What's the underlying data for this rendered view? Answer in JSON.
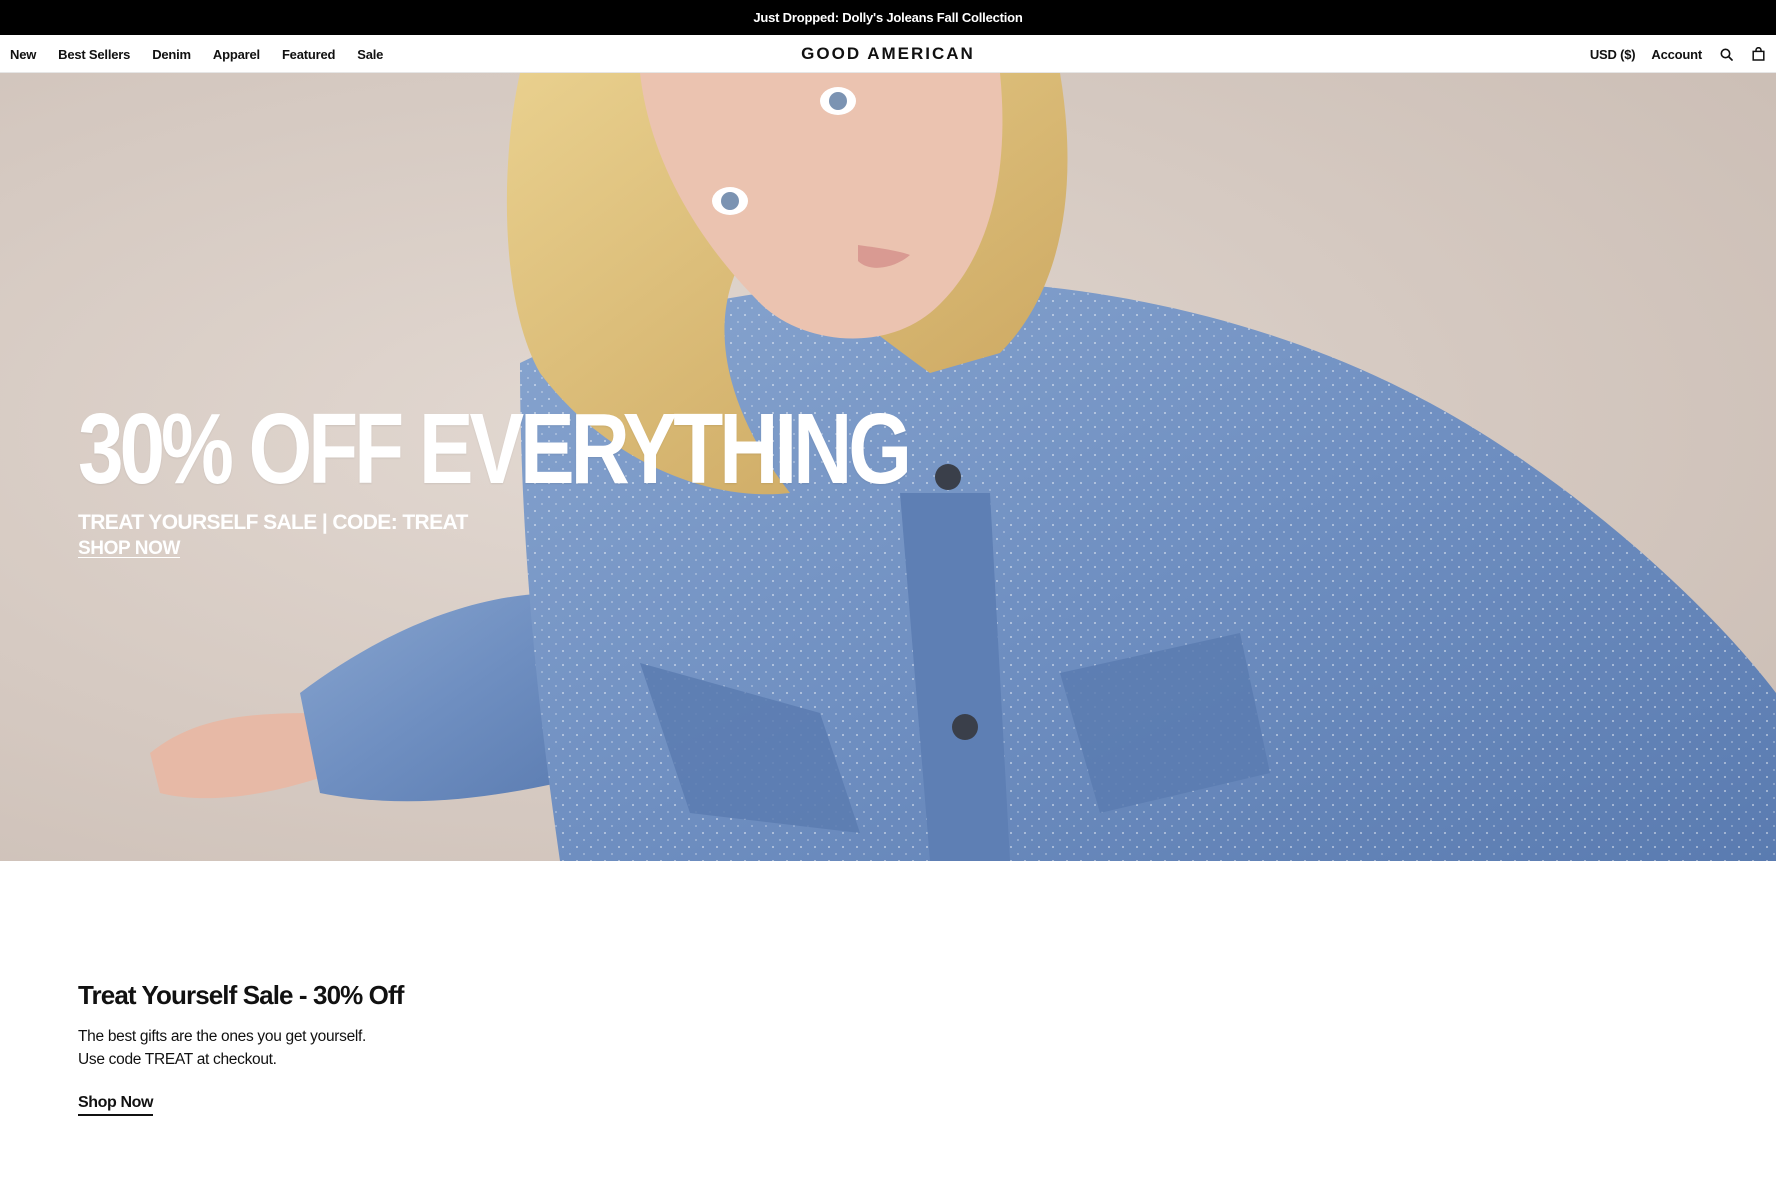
{
  "announcement": {
    "text": "Just Dropped: Dolly's Joleans Fall Collection"
  },
  "header": {
    "nav_left": [
      {
        "label": "New"
      },
      {
        "label": "Best Sellers"
      },
      {
        "label": "Denim"
      },
      {
        "label": "Apparel"
      },
      {
        "label": "Featured"
      },
      {
        "label": "Sale"
      }
    ],
    "logo": "GOOD AMERICAN",
    "currency": "USD ($)",
    "account": "Account",
    "icons": [
      "search-icon",
      "bag-icon"
    ]
  },
  "hero": {
    "headline": "30% OFF EVERYTHING",
    "subheadline": "TREAT YOURSELF SALE | CODE: TREAT",
    "cta": "SHOP NOW",
    "image": "woman-in-denim-jacket"
  },
  "promo": {
    "title": "Treat Yourself Sale - 30% Off",
    "line1": "The best gifts are the ones you get yourself.",
    "line2": "Use code TREAT at checkout.",
    "cta": "Shop Now"
  },
  "colors": {
    "announcement_bg": "#000000",
    "text": "#111111",
    "background": "#ffffff",
    "denim": "#6f8fc1"
  }
}
